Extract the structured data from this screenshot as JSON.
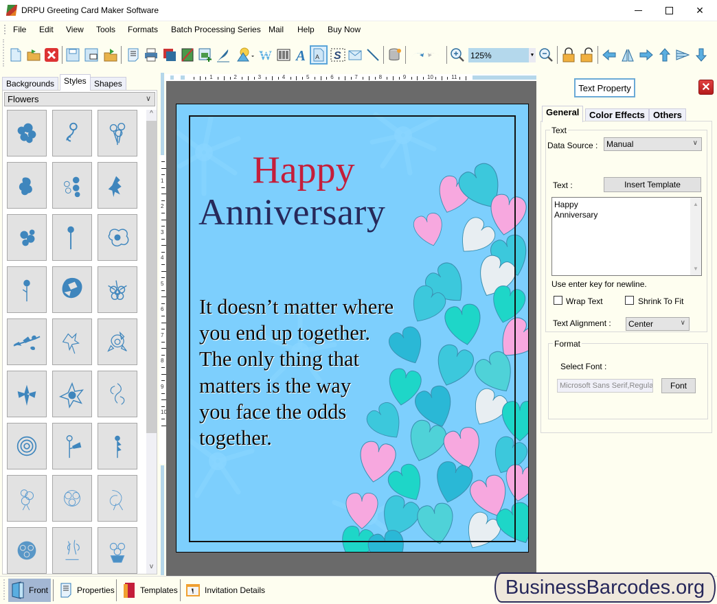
{
  "window": {
    "title": "DRPU Greeting Card Maker Software",
    "controls": {
      "minimize": "minimize",
      "maximize": "maximize",
      "close": "close"
    }
  },
  "menu": [
    "File",
    "Edit",
    "View",
    "Tools",
    "Formats",
    "Batch Processing Series",
    "Mail",
    "Help",
    "Buy Now"
  ],
  "toolbar": {
    "zoom_value": "125%",
    "buttons": [
      "new",
      "open",
      "close",
      "save",
      "save-as",
      "export",
      "properties",
      "print",
      "background",
      "picture-crop",
      "insert-image",
      "signature",
      "shapes",
      "wordart",
      "barcode",
      "text",
      "text-box",
      "styled-text",
      "email",
      "line",
      "database",
      "undo",
      "redo",
      "zoom-in",
      "zoom",
      "zoom-out",
      "lock",
      "unlock",
      "move-left",
      "flip",
      "move-right",
      "move-up",
      "align",
      "move-down"
    ]
  },
  "left_panel": {
    "tabs": [
      "Backgrounds",
      "Styles",
      "Shapes"
    ],
    "active_tab": "Styles",
    "category": "Flowers",
    "item_count": 27
  },
  "ruler": {
    "horizontal": [
      "1",
      "2",
      "3",
      "4",
      "5",
      "6",
      "7",
      "8",
      "9",
      "10",
      "11"
    ],
    "vertical": [
      "1",
      "2",
      "3",
      "4",
      "5",
      "6",
      "7",
      "8",
      "9",
      "10"
    ]
  },
  "card": {
    "heading1": "Happy",
    "heading2": "Anniversary",
    "body_lines": [
      "It doesn’t matter where",
      "you end up together.",
      "The only thing that",
      "matters is the way",
      "you face the odds",
      "together."
    ],
    "colors": {
      "background": "#7dcffd",
      "heading1": "#c41e3a",
      "heading2": "#27295a"
    }
  },
  "right_panel": {
    "title": "Text Property",
    "tabs": [
      "General",
      "Color Effects",
      "Others"
    ],
    "active_tab": "General",
    "text_group": {
      "legend": "Text",
      "data_source_label": "Data Source :",
      "data_source_value": "Manual",
      "text_label": "Text :",
      "insert_template": "Insert Template",
      "text_lines": [
        "Happy",
        "Anniversary"
      ],
      "hint": "Use enter key for newline.",
      "wrap_text": {
        "label": "Wrap Text",
        "checked": false
      },
      "shrink_to_fit": {
        "label": "Shrink To Fit",
        "checked": false
      },
      "alignment_label": "Text Alignment :",
      "alignment_value": "Center"
    },
    "format_group": {
      "legend": "Format",
      "select_font_label": "Select Font :",
      "font_value": "Microsoft Sans Serif,Regular",
      "font_button": "Font"
    }
  },
  "bottom_bar": {
    "items": [
      {
        "label": "Front",
        "active": true
      },
      {
        "label": "Properties",
        "active": false
      },
      {
        "label": "Templates",
        "active": false
      },
      {
        "label": "Invitation Details",
        "active": false
      }
    ]
  },
  "watermark": "BusinessBarcodes.org"
}
